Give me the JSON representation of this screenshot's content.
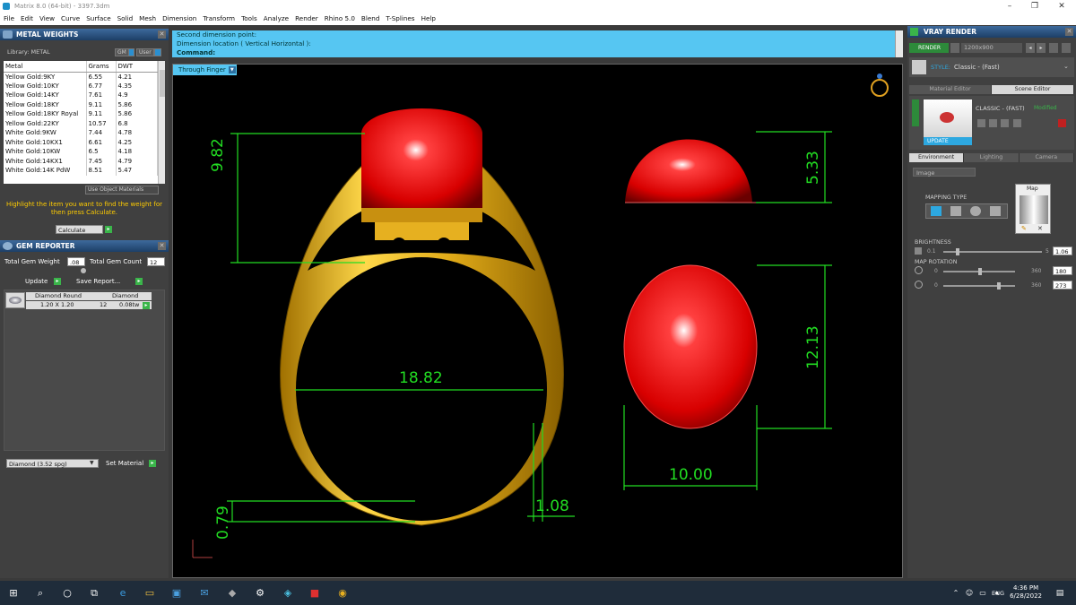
{
  "window": {
    "title": "Matrix 8.0 (64-bit) - 3397.3dm"
  },
  "menu": [
    "File",
    "Edit",
    "View",
    "Curve",
    "Surface",
    "Solid",
    "Mesh",
    "Dimension",
    "Transform",
    "Tools",
    "Analyze",
    "Render",
    "Rhino 5.0",
    "Blend",
    "T-Splines",
    "Help"
  ],
  "metal_weights": {
    "title": "METAL WEIGHTS",
    "library_label": "Library: METAL",
    "unit_gm": "GM",
    "unit_user": "User",
    "columns": [
      "Metal",
      "Grams",
      "DWT"
    ],
    "rows": [
      [
        "Yellow Gold:9KY",
        "6.55",
        "4.21"
      ],
      [
        "Yellow Gold:10KY",
        "6.77",
        "4.35"
      ],
      [
        "Yellow Gold:14KY",
        "7.61",
        "4.9"
      ],
      [
        "Yellow Gold:18KY",
        "9.11",
        "5.86"
      ],
      [
        "Yellow Gold:18KY Royal",
        "9.11",
        "5.86"
      ],
      [
        "Yellow Gold:22KY",
        "10.57",
        "6.8"
      ],
      [
        "White Gold:9KW",
        "7.44",
        "4.78"
      ],
      [
        "White Gold:10KX1",
        "6.61",
        "4.25"
      ],
      [
        "White Gold:10KW",
        "6.5",
        "4.18"
      ],
      [
        "White Gold:14KX1",
        "7.45",
        "4.79"
      ],
      [
        "White Gold:14K PdW",
        "8.51",
        "5.47"
      ]
    ],
    "use_object_materials": "Use Object Materials",
    "hint": "Highlight the item you want to find the weight for then press Calculate.",
    "calculate": "Calculate"
  },
  "gem_reporter": {
    "title": "GEM REPORTER",
    "total_gem_weight_label": "Total Gem Weight",
    "total_gem_weight": ".08",
    "total_gem_count_label": "Total Gem Count",
    "total_gem_count": "12",
    "update": "Update",
    "save_report": "Save Report...",
    "gem": {
      "name": "Diamond Round",
      "size": "1.20 X 1.20",
      "type": "Diamond",
      "count": "12",
      "weight": "0.08tw"
    },
    "material_select": "Diamond  (3.52 spg)",
    "set_material": "Set Material"
  },
  "command": {
    "line1": "Second dimension point:",
    "line2": "Dimension location ( Vertical  Horizontal ):",
    "prompt": "Command:"
  },
  "viewport": {
    "tab": "Through Finger",
    "dims": {
      "height_top": "9.82",
      "ring_width": "18.82",
      "bottom": "0.79",
      "shank": "1.08",
      "stone_height": "5.33",
      "stone_length": "12.13",
      "stone_width": "10.00"
    }
  },
  "vray": {
    "title": "VRAY RENDER",
    "render_btn": "RENDER",
    "resolution": "1200x900",
    "style_label": "STYLE:",
    "style_value": "Classic - (Fast)",
    "tabs1": [
      "Material Editor",
      "Scene Editor"
    ],
    "preset_name": "CLASSIC - (FAST)",
    "modified": "Modified",
    "update": "UPDATE",
    "tabs2": [
      "Environment",
      "Lighting",
      "Camera"
    ],
    "env_type": "Image",
    "mapping_type": "MAPPING TYPE",
    "map_label": "Map",
    "brightness_label": "BRIGHTNESS",
    "brightness_min": "0.1",
    "brightness_max": "5",
    "brightness_value": "1.06",
    "rotation_label": "MAP ROTATION",
    "rot1_min": "0",
    "rot1_max": "360",
    "rot1_value": "180",
    "rot2_min": "0",
    "rot2_max": "360",
    "rot2_value": "273"
  },
  "taskbar": {
    "lang": "ENG",
    "time": "4:36 PM",
    "date": "6/28/2022"
  },
  "colors": {
    "gold": "#e0b020",
    "ruby": "#e01010",
    "dim": "#22dd22",
    "cmd": "#56c6f2"
  }
}
